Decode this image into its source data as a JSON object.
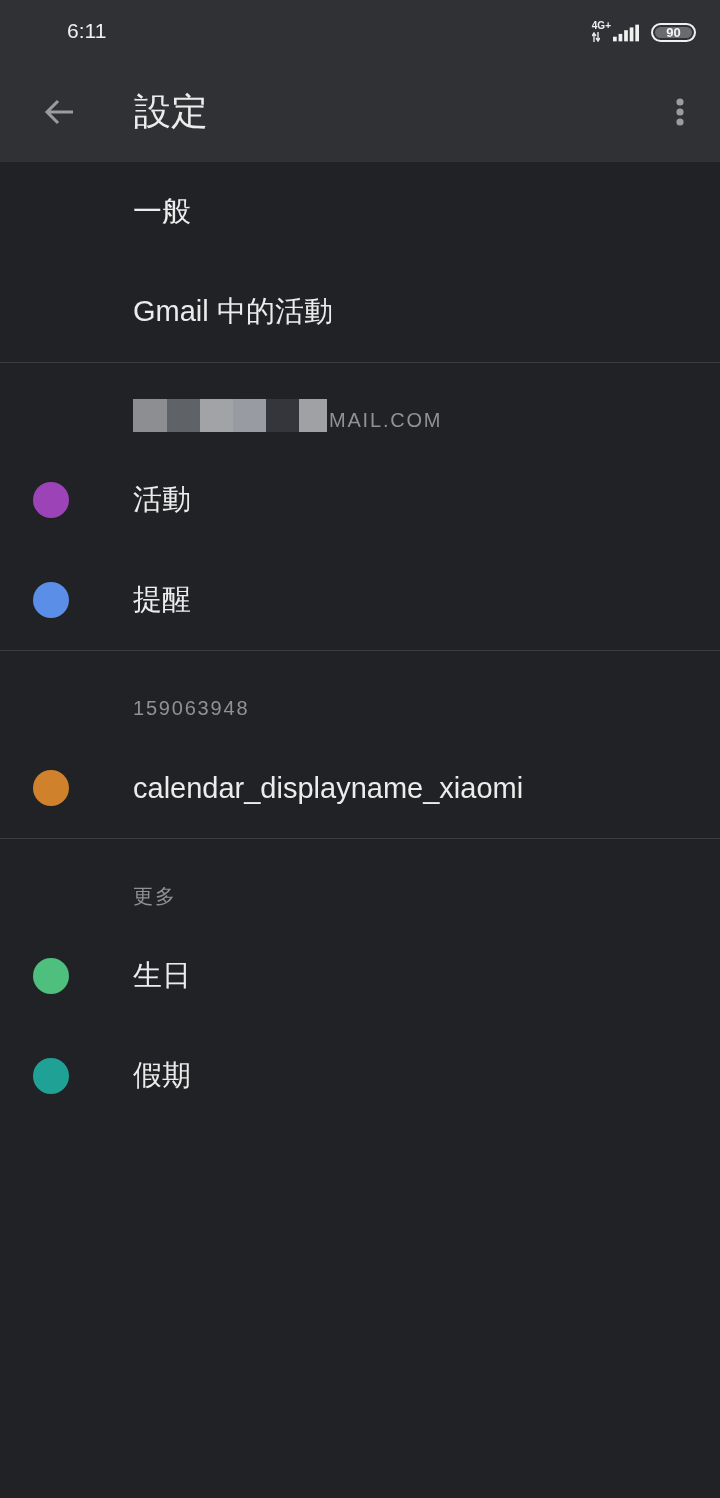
{
  "status_bar": {
    "time": "6:11",
    "network": "4G+",
    "battery": "90"
  },
  "app_bar": {
    "title": "設定"
  },
  "sections": [
    {
      "items": [
        {
          "label": "一般"
        },
        {
          "label": "Gmail 中的活動"
        }
      ]
    },
    {
      "header": "MAIL.COM",
      "redacted": true,
      "items": [
        {
          "label": "活動",
          "color": "#9c43b8"
        },
        {
          "label": "提醒",
          "color": "#5b8ee6"
        }
      ]
    },
    {
      "header": "159063948",
      "items": [
        {
          "label": "calendar_displayname_xiaomi",
          "color": "#d0812c"
        }
      ]
    },
    {
      "header": "更多",
      "items": [
        {
          "label": "生日",
          "color": "#4fbf7e"
        },
        {
          "label": "假期",
          "color": "#1fa295"
        }
      ]
    }
  ]
}
